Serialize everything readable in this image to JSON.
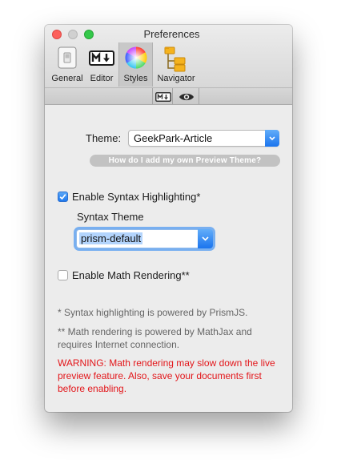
{
  "window": {
    "title": "Preferences"
  },
  "toolbar": {
    "tabs": [
      {
        "label": "General",
        "icon": "general-icon"
      },
      {
        "label": "Editor",
        "icon": "markdown-icon"
      },
      {
        "label": "Styles",
        "icon": "color-wheel-icon"
      },
      {
        "label": "Navigator",
        "icon": "folder-tree-icon"
      }
    ],
    "selected": "Styles"
  },
  "subbar": {
    "segments": [
      {
        "icon": "markdown-icon"
      },
      {
        "icon": "eye-icon"
      }
    ]
  },
  "theme": {
    "label": "Theme:",
    "value": "GeekPark-Article",
    "help_button": "How do I add my own Preview Theme?"
  },
  "syntax": {
    "checkbox_label": "Enable Syntax Highlighting*",
    "checked": true,
    "theme_label": "Syntax Theme",
    "theme_value": "prism-default"
  },
  "math": {
    "checkbox_label": "Enable Math Rendering**",
    "checked": false
  },
  "notes": {
    "syntax_note": "* Syntax highlighting is powered by PrismJS.",
    "math_note": "** Math rendering is powered by MathJax and requires Internet connection.",
    "warning": "WARNING: Math rendering may slow down the live preview feature. Also, save your documents first before enabling."
  },
  "colors": {
    "accent": "#1f79ee",
    "warning": "#e3161a",
    "help_button_bg": "#c2c2c2"
  }
}
